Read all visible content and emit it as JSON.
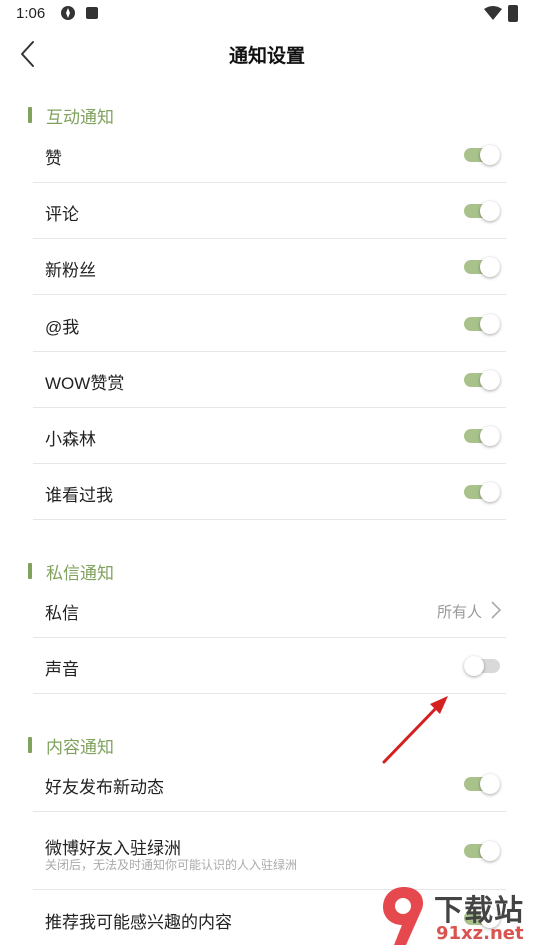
{
  "status_bar": {
    "time": "1:06"
  },
  "header": {
    "title": "通知设置"
  },
  "sections": [
    {
      "title": "互动通知",
      "items": [
        {
          "label": "赞",
          "enabled": true
        },
        {
          "label": "评论",
          "enabled": true
        },
        {
          "label": "新粉丝",
          "enabled": true
        },
        {
          "label": "@我",
          "enabled": true
        },
        {
          "label": "WOW赞赏",
          "enabled": true
        },
        {
          "label": "小森林",
          "enabled": true
        },
        {
          "label": "谁看过我",
          "enabled": true
        }
      ]
    },
    {
      "title": "私信通知",
      "items": [
        {
          "label": "私信",
          "value": "所有人"
        },
        {
          "label": "声音",
          "enabled": false
        }
      ]
    },
    {
      "title": "内容通知",
      "items": [
        {
          "label": "好友发布新动态",
          "enabled": true
        },
        {
          "label": "微博好友入驻绿洲",
          "sub": "关闭后，无法及时通知你可能认识的人入驻绿洲",
          "enabled": true
        },
        {
          "label": "推荐我可能感兴趣的内容",
          "enabled": true
        }
      ]
    }
  ],
  "colors": {
    "accent": "#7fa25d",
    "toggle_on": "#a9c28c",
    "toggle_off": "#d9d9d9",
    "arrow": "#d42020"
  },
  "watermark": {
    "top": "下载站",
    "bottom": "91xz.net"
  }
}
